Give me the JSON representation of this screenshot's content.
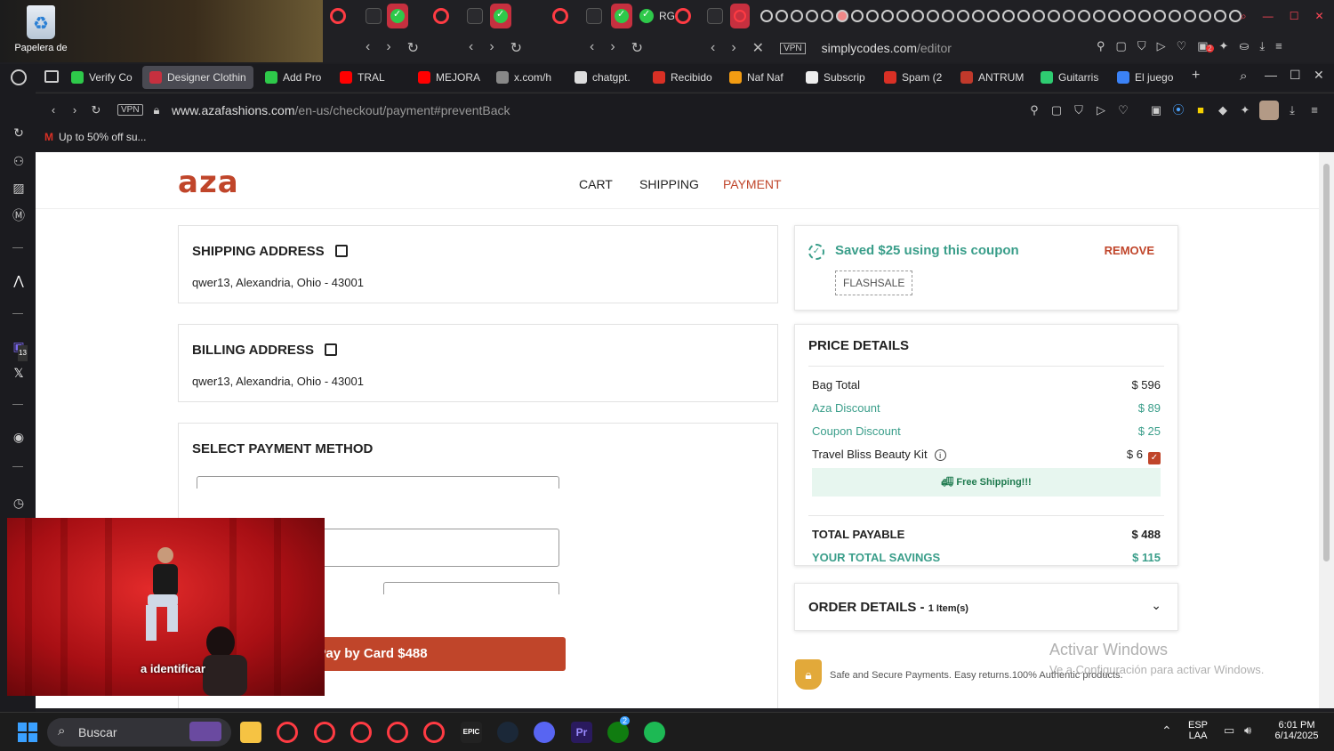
{
  "desktop": {
    "recycle_label": "Papelera de"
  },
  "back_window": {
    "address_host": "simplycodes.com",
    "address_path": "/editor",
    "vpn_label": "VPN",
    "tab_fragment": "RG",
    "notification_count": "2"
  },
  "tabs": [
    {
      "label": "Verify Co",
      "color": "#2ec94a"
    },
    {
      "label": "Designer Clothin",
      "color": "#c6303f",
      "active": true
    },
    {
      "label": "Add Pro",
      "color": "#2ec94a"
    },
    {
      "label": "TRAL",
      "color": "#ff0000"
    },
    {
      "label": "MEJORA",
      "color": "#ff0000"
    },
    {
      "label": "x.com/h",
      "color": "#888888"
    },
    {
      "label": "chatgpt.",
      "color": "#dddddd"
    },
    {
      "label": "Recibido",
      "color": "#d93025"
    },
    {
      "label": "Naf Naf",
      "color": "#f39c12"
    },
    {
      "label": "Subscrip",
      "color": "#eeeeee"
    },
    {
      "label": "Spam (2",
      "color": "#d93025"
    },
    {
      "label": "ANTRUM",
      "color": "#c0392b"
    },
    {
      "label": "Guitarris",
      "color": "#2ecc71"
    },
    {
      "label": "El juego",
      "color": "#3b82f6"
    }
  ],
  "address": {
    "vpn": "VPN",
    "host": "www.azafashions.com",
    "path": "/en-us/checkout/payment#preventBack"
  },
  "bookmark": {
    "label": "Up to 50% off su..."
  },
  "page": {
    "logo": "aza",
    "steps": {
      "cart": "CART",
      "shipping": "SHIPPING",
      "payment": "PAYMENT"
    },
    "shipping": {
      "title": "SHIPPING ADDRESS",
      "address": "qwer13, Alexandria, Ohio - 43001"
    },
    "billing": {
      "title": "BILLING ADDRESS",
      "address": "qwer13, Alexandria, Ohio - 43001"
    },
    "payment_method": {
      "title": "SELECT PAYMENT METHOD",
      "pay_button": "Pay by Card $488"
    },
    "coupon": {
      "saved_text": "Saved $25 using this coupon",
      "remove": "REMOVE",
      "code": "FLASHSALE"
    },
    "price": {
      "title": "PRICE DETAILS",
      "bag_total_label": "Bag Total",
      "bag_total": "$ 596",
      "aza_discount_label": "Aza Discount",
      "aza_discount": "$ 89",
      "coupon_discount_label": "Coupon Discount",
      "coupon_discount": "$ 25",
      "beauty_kit_label": "Travel Bliss Beauty Kit",
      "beauty_kit": "$ 6",
      "free_shipping": "Free Shipping!!!",
      "total_label": "TOTAL PAYABLE",
      "total": "$ 488",
      "savings_label": "YOUR TOTAL SAVINGS",
      "savings": "$ 115"
    },
    "order": {
      "title": "ORDER DETAILS -",
      "items": "1 Item(s)"
    },
    "secure_text": "Safe and Secure Payments. Easy returns.100% Authentic products."
  },
  "video": {
    "caption": "a identificar"
  },
  "watermark": {
    "line1": "Activar Windows",
    "line2": "Ve a Configuración para activar Windows."
  },
  "taskbar": {
    "search": "Buscar",
    "lang1": "ESP",
    "lang2": "LAA",
    "time": "6:01 PM",
    "date": "6/14/2025",
    "xbox_badge": "2",
    "epic_label": "EPIC"
  },
  "sidebar": {
    "teams_badge": "13"
  },
  "colors": {
    "accent": "#c0452a",
    "teal": "#3a9e8a",
    "opera": "#ff3b43"
  }
}
